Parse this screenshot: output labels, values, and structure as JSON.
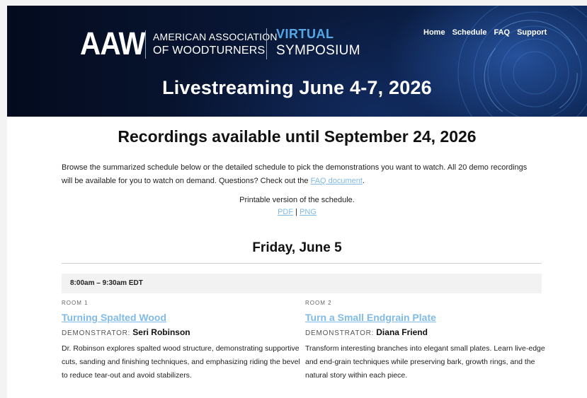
{
  "header": {
    "logo_abbr": "AAW",
    "org_line1": "AMERICAN ASSOCIATION",
    "org_line2": "OF WOODTURNERS",
    "virtual": "VIRTUAL",
    "symposium": "SYMPOSIUM",
    "nav": [
      "Home",
      "Schedule",
      "FAQ",
      "Support"
    ],
    "banner_title": "Livestreaming June 4-7, 2026"
  },
  "main": {
    "recordings_title": "Recordings available until September 24, 2026",
    "intro_text": "Browse the summarized schedule below or the detailed schedule to pick the demonstrations you want to watch. All 20 demo recordings will be available for you to watch on demand. Questions? Check out the ",
    "faq_link": "FAQ document",
    "intro_end": ".",
    "printable_label": "Printable version of the schedule.",
    "pdf_link": "PDF",
    "separator": " | ",
    "png_link": "PNG",
    "day_title": "Friday, June 5",
    "time_slot": "8:00am – 9:30am EDT",
    "sessions": [
      {
        "room": "ROOM 1",
        "title": "Turning Spalted Wood",
        "demonstrator_label": "DEMONSTRATOR:",
        "demonstrator": "Seri Robinson",
        "description": "Dr. Robinson explores spalted wood structure, demonstrating supportive cuts, sanding and finishing techniques, and emphasizing riding the bevel to reduce tear-out and avoid stabilizers."
      },
      {
        "room": "ROOM 2",
        "title": "Turn a Small Endgrain Plate",
        "demonstrator_label": "DEMONSTRATOR:",
        "demonstrator": "Diana Friend",
        "description": "Transform interesting branches into elegant small plates. Learn live-edge and end-grain techniques while preserving bark, growth rings, and the natural story within each piece."
      }
    ]
  },
  "colors": {
    "accent_blue": "#55a7e6",
    "link_blue": "#7fbbe6",
    "header_bg": "#0a1a3c"
  }
}
